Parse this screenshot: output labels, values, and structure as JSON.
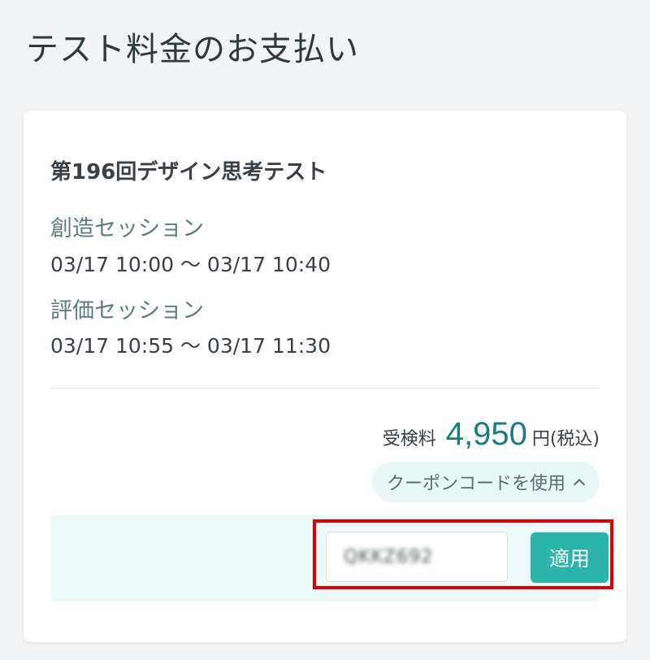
{
  "header": {
    "title": "テスト料金のお支払い"
  },
  "test": {
    "name": "第196回デザイン思考テスト",
    "sessions": [
      {
        "label": "創造セッション",
        "time": "03/17 10:00 〜 03/17 10:40"
      },
      {
        "label": "評価セッション",
        "time": "03/17 10:55 〜 03/17 11:30"
      }
    ]
  },
  "fee": {
    "label": "受検料",
    "amount": "4,950",
    "unit": "円(税込)"
  },
  "coupon": {
    "toggle_label": "クーポンコードを使用",
    "toggle_icon": "chevron-up-icon",
    "input_value": "QKKZ692",
    "apply_label": "適用"
  },
  "colors": {
    "accent": "#2ab4aa",
    "amount": "#1f7a80",
    "highlight": "#e00000",
    "coupon_panel_bg": "#eef9f9",
    "page_bg": "#f2f3f5"
  }
}
